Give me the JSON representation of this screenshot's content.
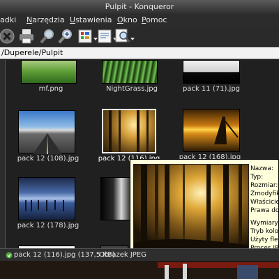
{
  "window": {
    "title": "Pulpit - Konqueror"
  },
  "menu": [
    "adki",
    "Narzędzia",
    "Ustawienia",
    "Okno",
    "Pomoc"
  ],
  "toolbar": {
    "icons": [
      "stop-icon",
      "print-icon",
      "zoom-out-icon",
      "zoom-in-icon",
      "view-mode-icon",
      "preview-icon",
      "find-icon"
    ]
  },
  "location": {
    "path": "/Duperele/Pulpit"
  },
  "files": [
    {
      "name": "mf.png"
    },
    {
      "name": "NightGrass.jpg"
    },
    {
      "name": "pack 11 (71).jpg"
    },
    {
      "name": "pack 12 (108).jpg"
    },
    {
      "name": "pack 12 (116).jpg",
      "selected": true
    },
    {
      "name": "pack 12 (168).jpg"
    },
    {
      "name": "pack 12 (178).jpg"
    }
  ],
  "tooltip": {
    "labels": [
      "Nazwa:",
      "Typ:",
      "Rozmiar:",
      "Zmodyfikow",
      "Właściciel:",
      "Prawa dost",
      "Wymiary:",
      "Tryb koloró",
      "Użyty flesz:",
      "Proces JPEG"
    ]
  },
  "status": {
    "file": "pack 12 (116).jpg (137,5 KB)",
    "type": "Obrazek JPEG"
  },
  "colors": {
    "tooltip_bg": "#ffffdc",
    "location_bg": "#f2f2f2",
    "toolbar_bg": "#2a2a2a"
  }
}
